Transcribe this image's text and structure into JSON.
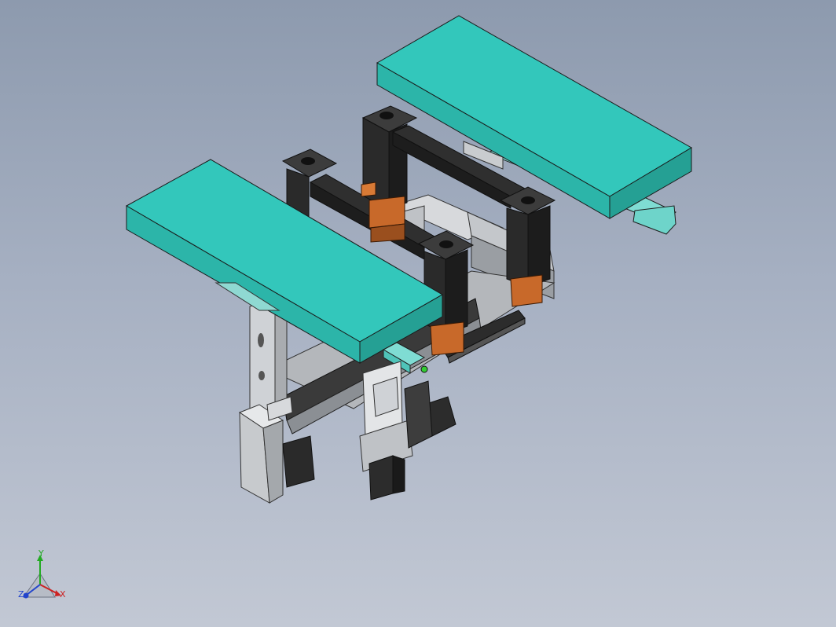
{
  "viewport": {
    "background_top": "#8d9aae",
    "background_bottom": "#c2c8d4"
  },
  "model": {
    "tables_color": "#33c7bb",
    "frame_color": "#2b2b2b",
    "adapter_color": "#c8692a",
    "rail_color": "#b9bcc0"
  },
  "triad": {
    "x_label": "X",
    "y_label": "Y",
    "z_label": "Z",
    "x_color": "#cc2222",
    "y_color": "#22aa22",
    "z_color": "#2244cc"
  }
}
